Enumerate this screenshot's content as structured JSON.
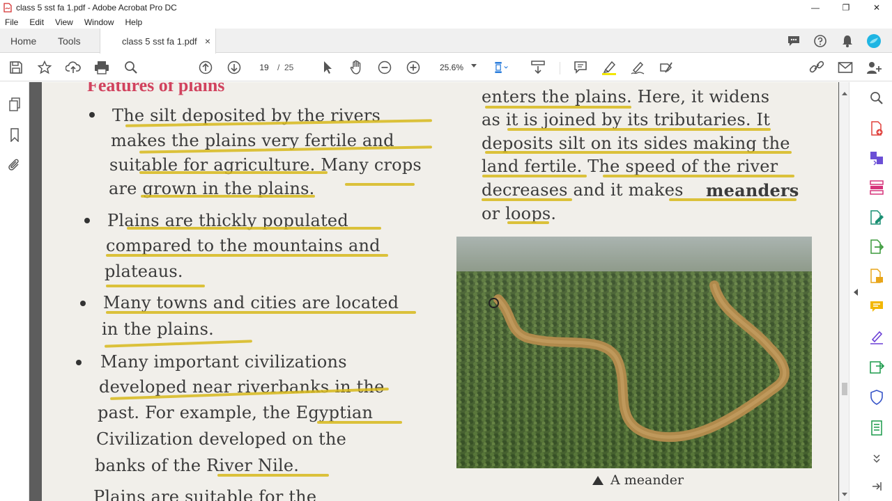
{
  "window": {
    "title": "class 5 sst fa 1.pdf - Adobe Acrobat Pro DC",
    "minimize": "—",
    "restore": "❐",
    "close": "✕"
  },
  "menu": [
    "File",
    "Edit",
    "View",
    "Window",
    "Help"
  ],
  "tabs": {
    "home": "Home",
    "tools": "Tools",
    "document": "class 5 sst fa 1.pdf",
    "document_close": "×"
  },
  "toolbar": {
    "page_current": "19",
    "page_sep": "/",
    "page_total": "25",
    "zoom": "25.6%"
  },
  "document": {
    "heading": "Features of plains",
    "left_lines": [
      "The silt deposited by the rivers",
      "makes the plains very fertile and",
      "suitable for agriculture. Many crops",
      "are grown in the plains.",
      "Plains are thickly populated",
      "compared to the mountains and",
      "plateaus.",
      "Many towns and cities are located",
      "in the plains.",
      "Many important civilizations",
      "developed near riverbanks in the",
      "past. For example, the Egyptian",
      "Civilization developed on the",
      "banks of the River Nile.",
      "Plains are suitable for the"
    ],
    "right_lines": [
      "enters the plains. Here, it widens",
      "as it is joined by its tributaries. It",
      "deposits silt on its sides making the",
      "land fertile. The speed of the river",
      "decreases and it makes",
      "meanders",
      "or loops."
    ],
    "caption": "A meander"
  },
  "colors": {
    "heading": "#d1425e",
    "highlight_underline": "#d7b91b",
    "page_background": "#f1efea",
    "accent_avatar": "#1fb5e3"
  }
}
